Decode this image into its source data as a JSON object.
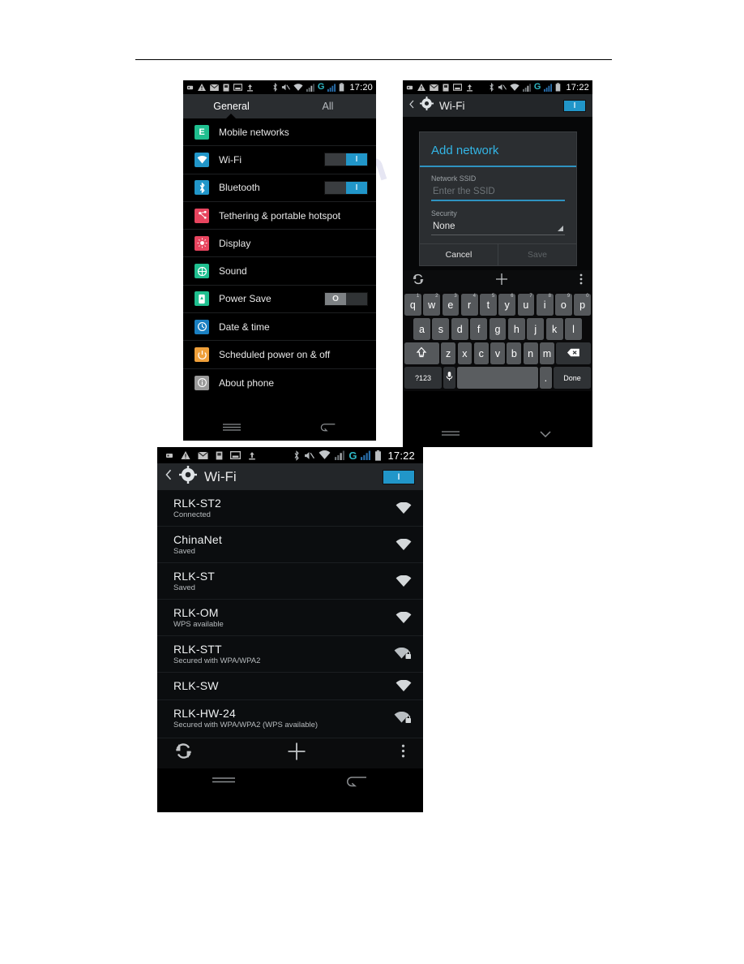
{
  "document": {
    "background": "#ffffff",
    "rule_color": "#000000"
  },
  "colors": {
    "accent_blue": "#33b5e5",
    "toggle_on": "#2196c9",
    "toggle_off": "#7d8184",
    "status_g": "#2fb7c4",
    "tab_active": "#ffffff",
    "tab_inactive": "#b8bcc0"
  },
  "screen1": {
    "name": "settings-general",
    "statusbar": {
      "time": "17:20",
      "g_label": "G",
      "left_icons": [
        "sim-icon",
        "warning-icon",
        "mail-icon",
        "sim-card-icon",
        "screenshot-icon",
        "usb-upload-icon"
      ],
      "right_icons": [
        "bluetooth-icon",
        "mute-icon",
        "wifi-icon",
        "signal-icon",
        "signal-icon-2",
        "battery-icon"
      ]
    },
    "tabs": [
      {
        "label": "General",
        "active": true
      },
      {
        "label": "All",
        "active": false
      }
    ],
    "items": [
      {
        "label": "Mobile networks",
        "icon": "mobile-networks-icon",
        "glyph": "E",
        "color": "#1fbf8f",
        "toggle": null
      },
      {
        "label": "Wi-Fi",
        "icon": "wifi-icon",
        "glyph": "",
        "color": "#2196c9",
        "toggle": "on"
      },
      {
        "label": "Bluetooth",
        "icon": "bluetooth-icon",
        "glyph": "",
        "color": "#2196c9",
        "toggle": "on"
      },
      {
        "label": "Tethering & portable hotspot",
        "icon": "tethering-icon",
        "glyph": "",
        "color": "#e8455f",
        "toggle": null
      },
      {
        "label": "Display",
        "icon": "display-icon",
        "glyph": "",
        "color": "#e8455f",
        "toggle": null
      },
      {
        "label": "Sound",
        "icon": "sound-icon",
        "glyph": "",
        "color": "#1fbf8f",
        "toggle": null
      },
      {
        "label": "Power Save",
        "icon": "power-save-icon",
        "glyph": "",
        "color": "#1fbf8f",
        "toggle": "off"
      },
      {
        "label": "Date & time",
        "icon": "clock-icon",
        "glyph": "",
        "color": "#1a7fc1",
        "toggle": null
      },
      {
        "label": "Scheduled power on & off",
        "icon": "power-icon",
        "glyph": "",
        "color": "#efa03a",
        "toggle": null
      },
      {
        "label": "About phone",
        "icon": "info-icon",
        "glyph": "",
        "color": "#9a9a9a",
        "toggle": null
      }
    ],
    "toggle_on_label": "I",
    "toggle_off_label": "O",
    "navbar": [
      "menu-icon",
      "back-icon"
    ]
  },
  "screen2": {
    "name": "wifi-add-network",
    "statusbar": {
      "time": "17:22",
      "g_label": "G"
    },
    "titlebar": {
      "title": "Wi-Fi",
      "toggle": "on",
      "toggle_label": "I"
    },
    "dialog": {
      "title": "Add network",
      "ssid_label": "Network SSID",
      "ssid_placeholder": "Enter the SSID",
      "ssid_value": "",
      "security_label": "Security",
      "security_value": "None",
      "cancel_label": "Cancel",
      "save_label": "Save"
    },
    "actionbar": [
      "wps-refresh-icon",
      "add-icon",
      "overflow-icon"
    ],
    "keyboard": {
      "row1": [
        {
          "k": "q",
          "n": "1"
        },
        {
          "k": "w",
          "n": "2"
        },
        {
          "k": "e",
          "n": "3"
        },
        {
          "k": "r",
          "n": "4"
        },
        {
          "k": "t",
          "n": "5"
        },
        {
          "k": "y",
          "n": "6"
        },
        {
          "k": "u",
          "n": "7"
        },
        {
          "k": "i",
          "n": "8"
        },
        {
          "k": "o",
          "n": "9"
        },
        {
          "k": "p",
          "n": "0"
        }
      ],
      "row2": [
        "a",
        "s",
        "d",
        "f",
        "g",
        "h",
        "j",
        "k",
        "l"
      ],
      "row3": [
        "z",
        "x",
        "c",
        "v",
        "b",
        "n",
        "m"
      ],
      "shift_label": "shift-icon",
      "backspace_label": "backspace-icon",
      "sym_label": "?123",
      "mic_label": "mic-icon",
      "period_label": ".",
      "done_label": "Done"
    },
    "navbar": [
      "menu-icon",
      "hide-keyboard-icon"
    ]
  },
  "screen3": {
    "name": "wifi-network-list",
    "statusbar": {
      "time": "17:22",
      "g_label": "G"
    },
    "titlebar": {
      "title": "Wi-Fi",
      "toggle": "on",
      "toggle_label": "I"
    },
    "networks": [
      {
        "ssid": "RLK-ST2",
        "status": "Connected",
        "secured": false
      },
      {
        "ssid": "ChinaNet",
        "status": "Saved",
        "secured": false
      },
      {
        "ssid": "RLK-ST",
        "status": "Saved",
        "secured": false
      },
      {
        "ssid": "RLK-OM",
        "status": "WPS available",
        "secured": false
      },
      {
        "ssid": "RLK-STT",
        "status": "Secured with WPA/WPA2",
        "secured": true
      },
      {
        "ssid": "RLK-SW",
        "status": "",
        "secured": false
      },
      {
        "ssid": "RLK-HW-24",
        "status": "Secured with WPA/WPA2 (WPS available)",
        "secured": true
      }
    ],
    "actionbar": [
      "wps-refresh-icon",
      "add-icon",
      "overflow-icon"
    ],
    "navbar": [
      "menu-icon",
      "back-icon"
    ]
  }
}
